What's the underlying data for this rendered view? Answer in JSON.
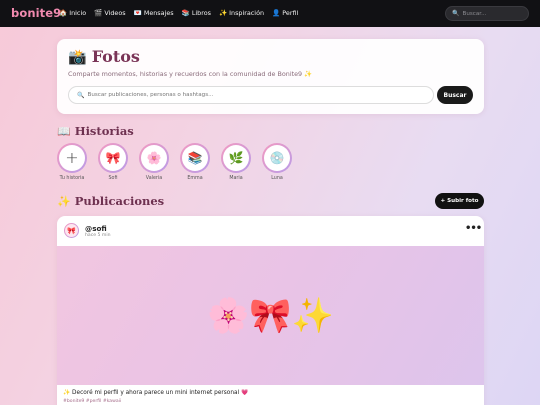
{
  "app": {
    "logo": "bonite9"
  },
  "nav": [
    {
      "icon": "🏠",
      "label": "Inicio"
    },
    {
      "icon": "🎬",
      "label": "Videos"
    },
    {
      "icon": "💌",
      "label": "Mensajes"
    },
    {
      "icon": "📚",
      "label": "Libros"
    },
    {
      "icon": "✨",
      "label": "Inspiración"
    },
    {
      "icon": "👤",
      "label": "Perfil"
    }
  ],
  "top_search": {
    "icon": "🔍",
    "placeholder": "Buscar..."
  },
  "hero": {
    "icon": "📸",
    "title": "Fotos",
    "description": "Comparte momentos, historias y recuerdos con la comunidad de Bonite9 ✨",
    "search_icon": "🔍",
    "search_placeholder": "Buscar publicaciones, personas o hashtags...",
    "search_button": "Buscar"
  },
  "stories_section": {
    "icon": "📖",
    "title": "Historias",
    "items": [
      {
        "icon": "+",
        "label": "Tu historia"
      },
      {
        "icon": "🎀",
        "label": "Sofi"
      },
      {
        "icon": "🌸",
        "label": "Valeria"
      },
      {
        "icon": "📚",
        "label": "Emma"
      },
      {
        "icon": "🌿",
        "label": "Maria"
      },
      {
        "icon": "💿",
        "label": "Luna"
      }
    ]
  },
  "posts_section": {
    "icon": "✨",
    "title": "Publicaciones",
    "upload_button": "+ Subir foto"
  },
  "post": {
    "avatar": "🎀",
    "username": "@sofi",
    "time": "hace 5 min",
    "menu": "•••",
    "image_emojis": "🌸🎀✨",
    "caption": "✨ Decoré mi perfil y ahora parece un mini internet personal 💗",
    "tags": "#bonite9 #perfil #kawaii"
  },
  "colors": {
    "topbar": "#111114",
    "logo": "#f08aaf",
    "heading": "#7a3457",
    "button_dark": "#1a1a1a"
  }
}
